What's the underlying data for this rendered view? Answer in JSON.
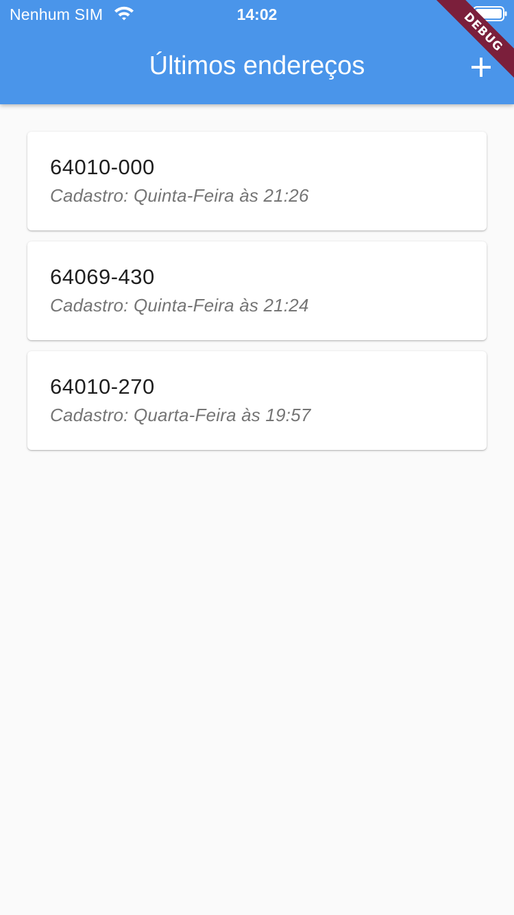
{
  "status_bar": {
    "carrier": "Nenhum SIM",
    "time": "14:02",
    "wifi_icon": "wifi-icon",
    "battery_icon": "battery-icon"
  },
  "appbar": {
    "title": "Últimos endereços",
    "add_icon": "plus-icon",
    "background_color": "#4a95ea"
  },
  "debug_banner": {
    "label": "DEBUG",
    "color": "#7b1f3b"
  },
  "addresses": [
    {
      "cep": "64010-000",
      "registered": "Cadastro: Quinta-Feira às 21:26"
    },
    {
      "cep": "64069-430",
      "registered": "Cadastro: Quinta-Feira às 21:24"
    },
    {
      "cep": "64010-270",
      "registered": "Cadastro: Quarta-Feira às 19:57"
    }
  ]
}
